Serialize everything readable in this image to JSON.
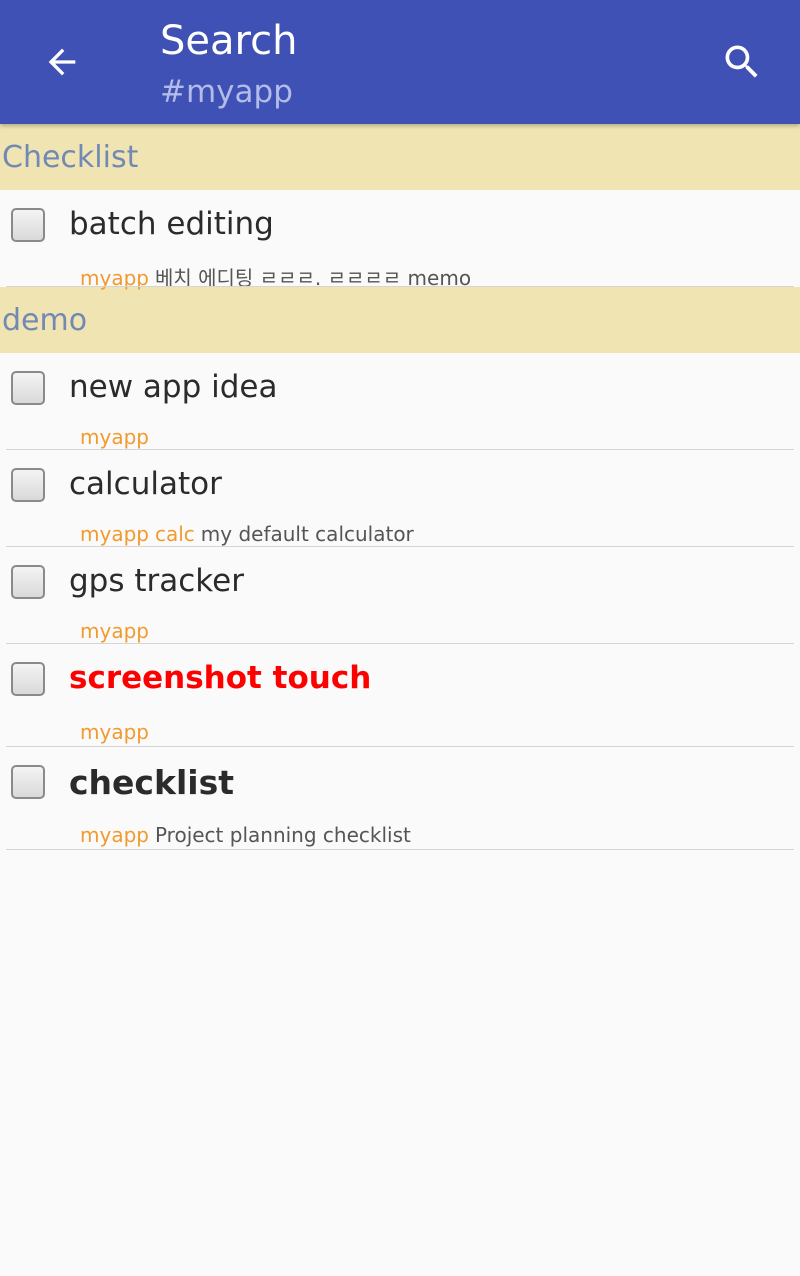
{
  "appbar": {
    "title": "Search",
    "subtitle": "#myapp",
    "back_icon": "arrow-left-icon",
    "search_icon": "search-icon",
    "color": "#3f51b5"
  },
  "sections": [
    {
      "name": "Checklist",
      "items": [
        {
          "title": "batch editing",
          "tags": [
            "myapp"
          ],
          "memo": "베치 에디팅 ㄹㄹㄹ. ㄹㄹㄹㄹ memo",
          "checked": false
        }
      ]
    },
    {
      "name": "demo",
      "items": [
        {
          "title": "new app idea",
          "tags": [
            "myapp"
          ],
          "memo": "",
          "checked": false
        },
        {
          "title": "calculator",
          "tags": [
            "myapp",
            "calc"
          ],
          "memo": "my default calculator",
          "checked": false
        },
        {
          "title": "gps tracker",
          "tags": [
            "myapp"
          ],
          "memo": "",
          "checked": false
        },
        {
          "title": "screenshot touch",
          "tags": [
            "myapp"
          ],
          "memo": "",
          "checked": false,
          "title_color": "#ff0000"
        },
        {
          "title": "checklist",
          "tags": [
            "myapp"
          ],
          "memo": "Project planning checklist",
          "checked": false
        }
      ]
    }
  ],
  "colors": {
    "section_bg": "#f0e5b2",
    "section_text": "#7289b5",
    "tag": "#f29a2e"
  }
}
